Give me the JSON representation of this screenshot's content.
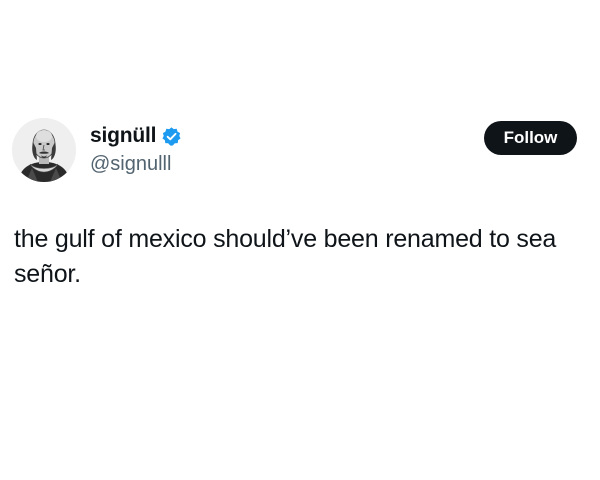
{
  "author": {
    "display_name": "signüll",
    "handle": "@signulll",
    "verified": true
  },
  "actions": {
    "follow_label": "Follow"
  },
  "post": {
    "text": "the gulf of mexico should’ve been renamed to sea señor."
  },
  "icons": {
    "avatar": "shakespeare-portrait",
    "badge": "verified-check-icon"
  },
  "colors": {
    "background": "#ffffff",
    "text_primary": "#0f1419",
    "text_secondary": "#536471",
    "verified_blue": "#1d9bf0",
    "button_bg": "#0f1419",
    "button_text": "#ffffff"
  }
}
